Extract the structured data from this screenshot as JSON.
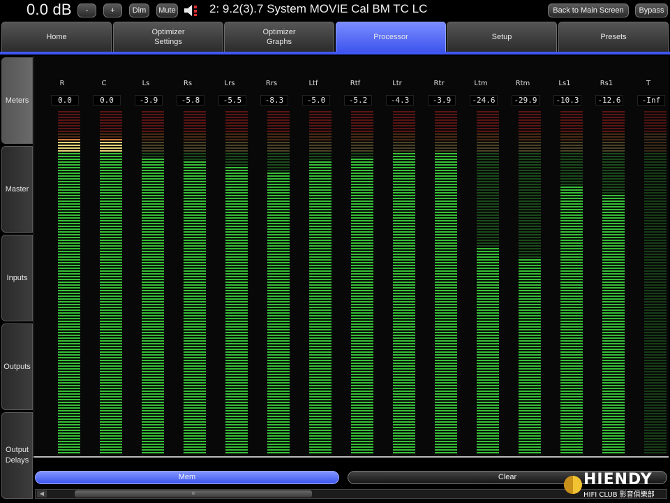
{
  "header": {
    "volume": "0.0 dB",
    "minus_label": "-",
    "plus_label": "+",
    "dim_label": "Dim",
    "mute_label": "Mute",
    "speaker_icon": "speaker-muted-icon",
    "preset_name": "2: 9.2(3).7 System MOVIE Cal BM TC LC",
    "back_label": "Back to Main Screen",
    "bypass_label": "Bypass"
  },
  "tabs": [
    {
      "label": "Home"
    },
    {
      "label": "Optimizer\nSettings"
    },
    {
      "label": "Optimizer\nGraphs"
    },
    {
      "label": "Processor",
      "active": true
    },
    {
      "label": "Setup"
    },
    {
      "label": "Presets"
    }
  ],
  "sidebar": [
    {
      "label": "Meters",
      "active": true
    },
    {
      "label": "Master"
    },
    {
      "label": "Inputs"
    },
    {
      "label": "Outputs"
    },
    {
      "label": "Output\nDelays"
    }
  ],
  "meters": [
    {
      "name": "R",
      "value": "0.0",
      "level": 0.92
    },
    {
      "name": "C",
      "value": "0.0",
      "level": 0.92
    },
    {
      "name": "Ls",
      "value": "-3.9",
      "level": 0.86
    },
    {
      "name": "Rs",
      "value": "-5.8",
      "level": 0.85
    },
    {
      "name": "Lrs",
      "value": "-5.5",
      "level": 0.84
    },
    {
      "name": "Rrs",
      "value": "-8.3",
      "level": 0.82
    },
    {
      "name": "Ltf",
      "value": "-5.0",
      "level": 0.85
    },
    {
      "name": "Rtf",
      "value": "-5.2",
      "level": 0.86
    },
    {
      "name": "Ltr",
      "value": "-4.3",
      "level": 0.88
    },
    {
      "name": "Rtr",
      "value": "-3.9",
      "level": 0.88
    },
    {
      "name": "Ltm",
      "value": "-24.6",
      "level": 0.6
    },
    {
      "name": "Rtm",
      "value": "-29.9",
      "level": 0.57
    },
    {
      "name": "Ls1",
      "value": "-10.3",
      "level": 0.78
    },
    {
      "name": "Rs1",
      "value": "-12.6",
      "level": 0.76
    },
    {
      "name": "T",
      "value": "-Inf",
      "level": 0.0
    }
  ],
  "colors": {
    "accent": "#3f57f5",
    "meter_green": "#38c038",
    "meter_green_dim": "#1b4a1b",
    "meter_yellow": "#e8d27a",
    "meter_orange": "#d07a3a",
    "meter_red": "#c0302c"
  },
  "footer": {
    "mem_label": "Mem",
    "clear_label": "Clear",
    "scroll_left_icon": "arrow-left-icon",
    "scroll_grip": "ıı"
  },
  "watermark": {
    "logo_text": "HIENDY",
    "logo_sub": "HIFI CLUB 影音俱樂部"
  }
}
